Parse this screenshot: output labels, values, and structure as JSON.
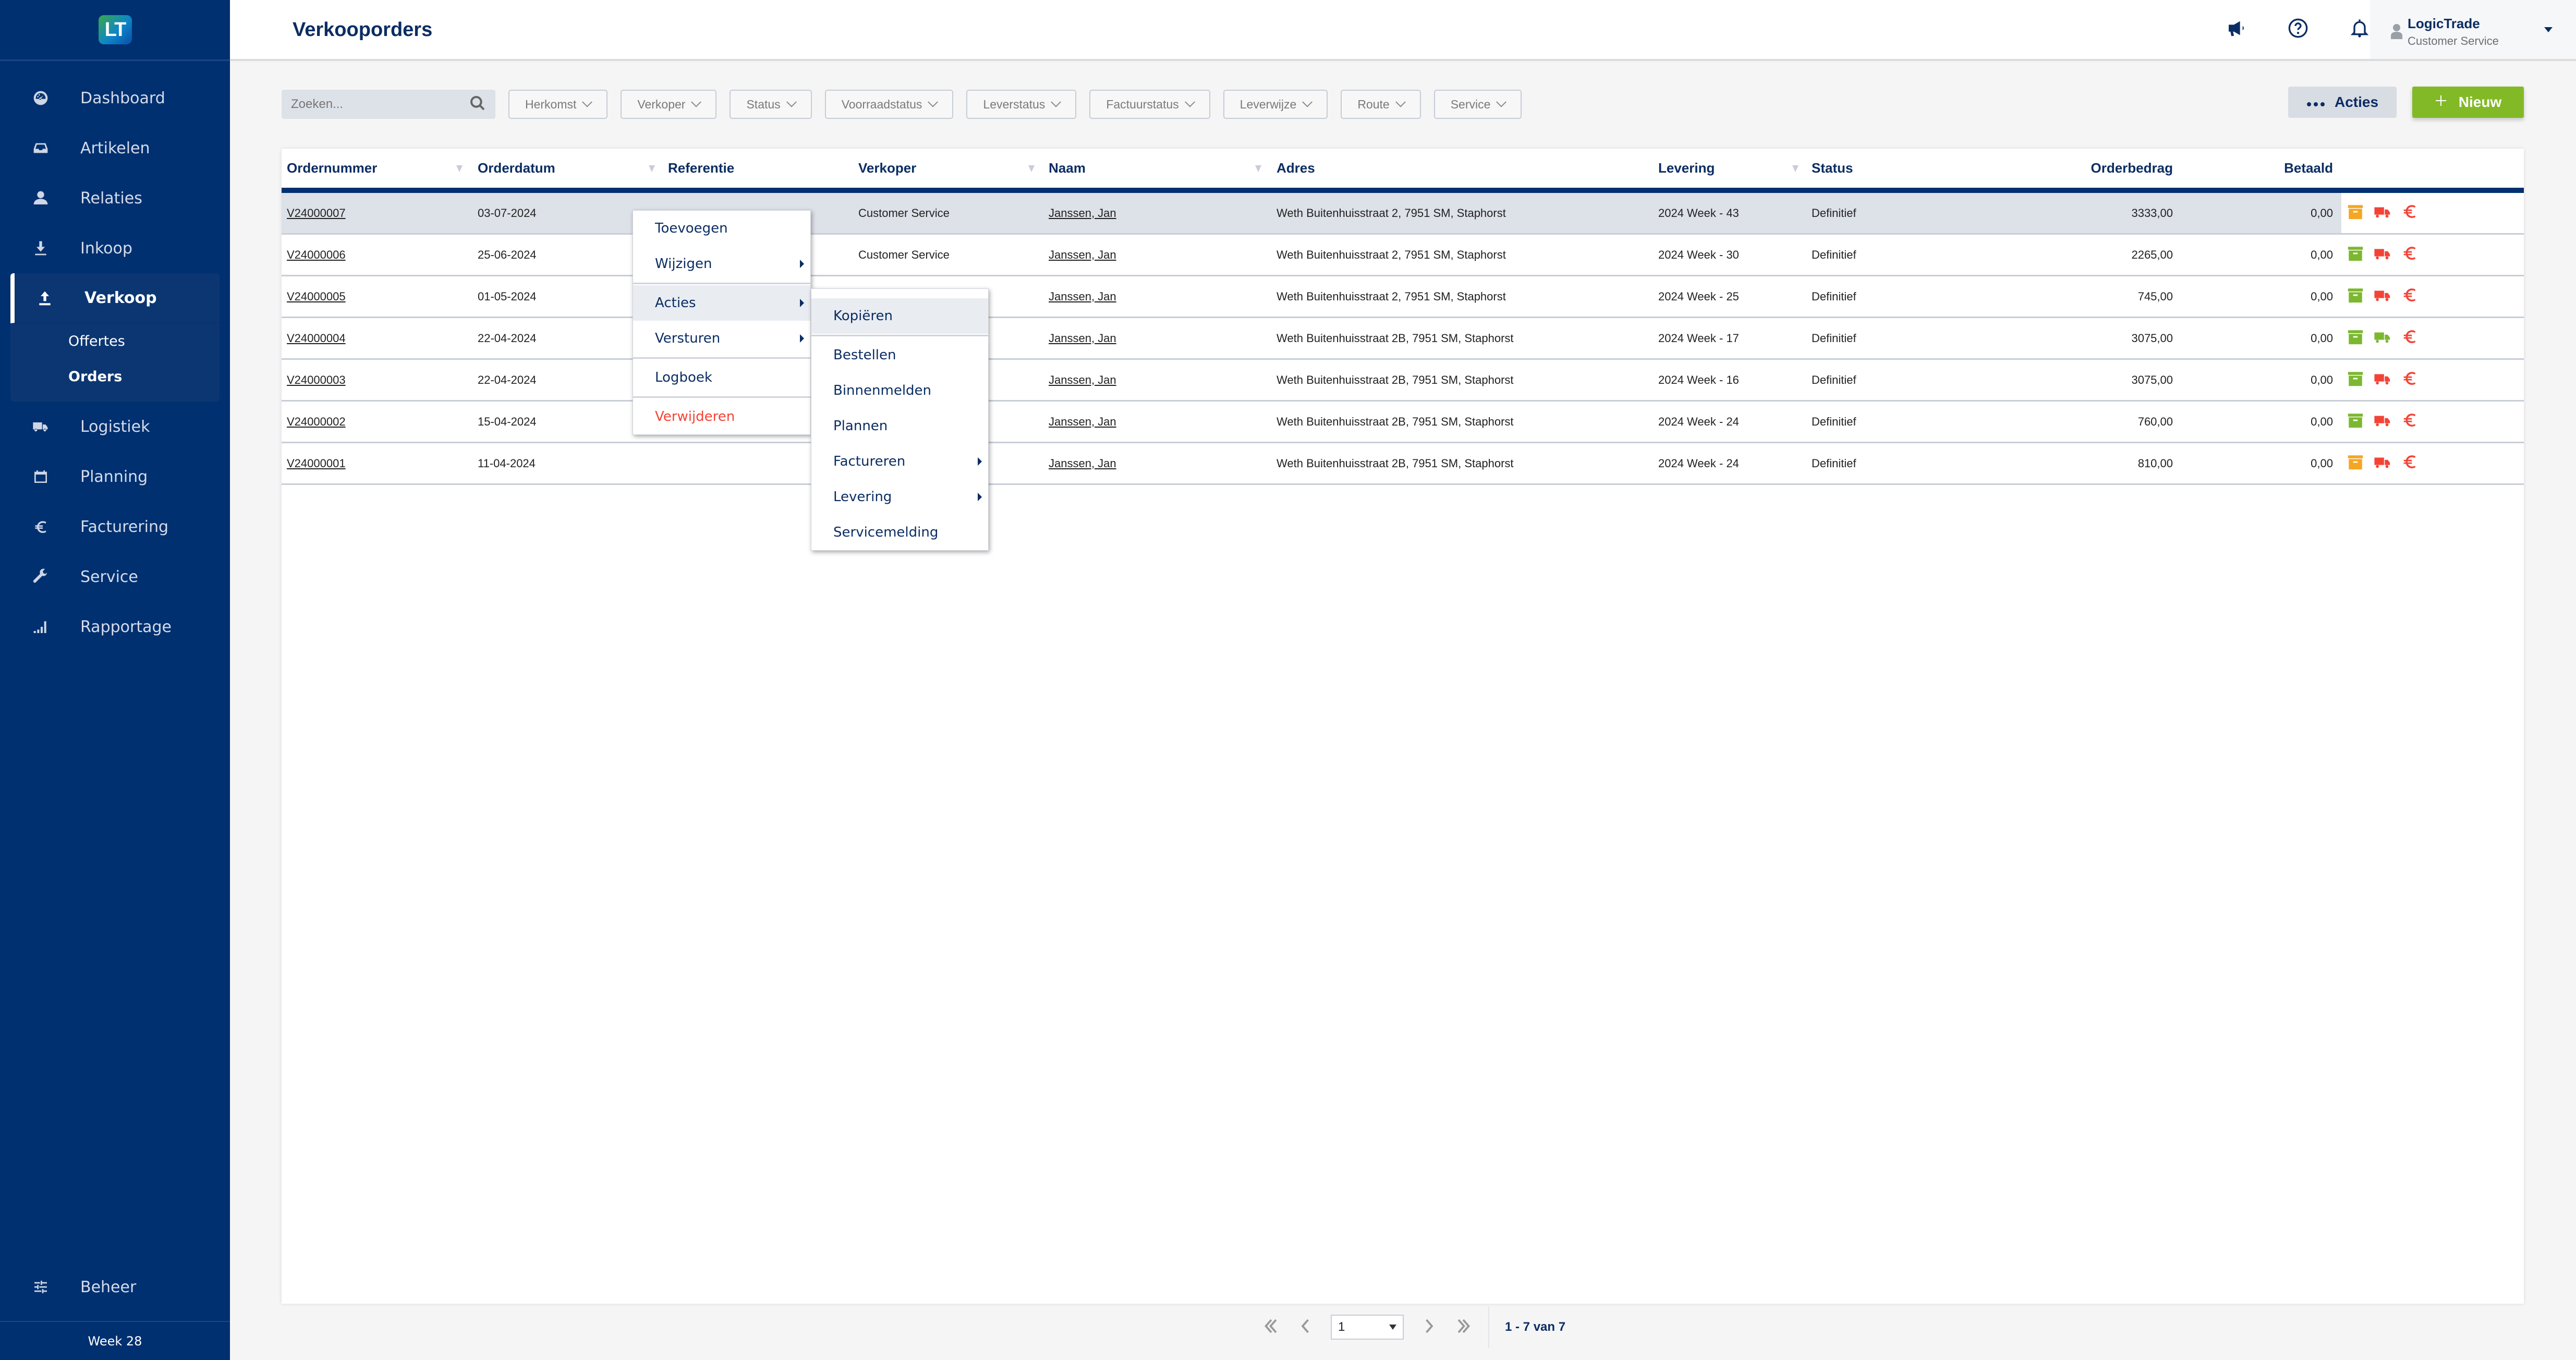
{
  "app": {
    "logo_text": "LT",
    "page_title": "Verkooporders",
    "week_label": "Week 28"
  },
  "sidebar": {
    "items": [
      {
        "label": "Dashboard",
        "icon": "dashboard-icon"
      },
      {
        "label": "Artikelen",
        "icon": "inbox-icon"
      },
      {
        "label": "Relaties",
        "icon": "user-icon"
      },
      {
        "label": "Inkoop",
        "icon": "download-icon"
      },
      {
        "label": "Verkoop",
        "icon": "upload-icon",
        "active": true,
        "children": [
          {
            "label": "Offertes"
          },
          {
            "label": "Orders",
            "active": true
          }
        ]
      },
      {
        "label": "Logistiek",
        "icon": "truck-icon"
      },
      {
        "label": "Planning",
        "icon": "calendar-icon"
      },
      {
        "label": "Facturering",
        "icon": "euro-icon"
      },
      {
        "label": "Service",
        "icon": "wrench-icon"
      },
      {
        "label": "Rapportage",
        "icon": "bar-chart-icon"
      }
    ],
    "bottom_item": {
      "label": "Beheer",
      "icon": "sliders-icon"
    }
  },
  "topbar": {
    "icons": [
      "megaphone-icon",
      "help-icon",
      "bell-icon"
    ],
    "user": {
      "name": "LogicTrade",
      "role": "Customer Service"
    }
  },
  "filters": {
    "search_placeholder": "Zoeken...",
    "dropdowns": [
      "Herkomst",
      "Verkoper",
      "Status",
      "Voorraadstatus",
      "Leverstatus",
      "Factuurstatus",
      "Leverwijze",
      "Route",
      "Service"
    ]
  },
  "actions": {
    "acties_label": "Acties",
    "nieuw_label": "Nieuw"
  },
  "table": {
    "columns": [
      "Ordernummer",
      "Orderdatum",
      "Referentie",
      "Verkoper",
      "Naam",
      "Adres",
      "Levering",
      "Status",
      "Orderbedrag",
      "Betaald"
    ],
    "rows": [
      {
        "ordernummer": "V24000007",
        "orderdatum": "03-07-2024",
        "referentie": "",
        "verkoper": "Customer  Service",
        "naam": "Janssen, Jan",
        "adres": "Weth Buitenhuisstraat 2, 7951 SM, Staphorst",
        "levering": "2024 Week - 43",
        "status": "Definitief",
        "orderbedrag": "3333,00",
        "betaald": "0,00",
        "box_color": "#f5a623",
        "truck_color": "#f44336",
        "euro_color": "#f44336",
        "selected": true
      },
      {
        "ordernummer": "V24000006",
        "orderdatum": "25-06-2024",
        "referentie": "",
        "verkoper": "Customer  Service",
        "naam": "Janssen, Jan",
        "adres": "Weth Buitenhuisstraat 2, 7951 SM, Staphorst",
        "levering": "2024 Week - 30",
        "status": "Definitief",
        "orderbedrag": "2265,00",
        "betaald": "0,00",
        "box_color": "#7cb82f",
        "truck_color": "#f44336",
        "euro_color": "#f44336"
      },
      {
        "ordernummer": "V24000005",
        "orderdatum": "01-05-2024",
        "referentie": "",
        "verkoper": "",
        "naam": "Janssen, Jan",
        "adres": "Weth Buitenhuisstraat 2, 7951 SM, Staphorst",
        "levering": "2024 Week - 25",
        "status": "Definitief",
        "orderbedrag": "745,00",
        "betaald": "0,00",
        "box_color": "#7cb82f",
        "truck_color": "#f44336",
        "euro_color": "#f44336"
      },
      {
        "ordernummer": "V24000004",
        "orderdatum": "22-04-2024",
        "referentie": "",
        "verkoper": "",
        "naam": "Janssen, Jan",
        "adres": "Weth Buitenhuisstraat 2B, 7951 SM, Staphorst",
        "levering": "2024 Week - 17",
        "status": "Definitief",
        "orderbedrag": "3075,00",
        "betaald": "0,00",
        "box_color": "#7cb82f",
        "truck_color": "#7cb82f",
        "euro_color": "#f44336"
      },
      {
        "ordernummer": "V24000003",
        "orderdatum": "22-04-2024",
        "referentie": "",
        "verkoper": "",
        "naam": "Janssen, Jan",
        "adres": "Weth Buitenhuisstraat 2B, 7951 SM, Staphorst",
        "levering": "2024 Week - 16",
        "status": "Definitief",
        "orderbedrag": "3075,00",
        "betaald": "0,00",
        "box_color": "#7cb82f",
        "truck_color": "#f44336",
        "euro_color": "#f44336"
      },
      {
        "ordernummer": "V24000002",
        "orderdatum": "15-04-2024",
        "referentie": "",
        "verkoper": "",
        "naam": "Janssen, Jan",
        "adres": "Weth Buitenhuisstraat 2B, 7951 SM, Staphorst",
        "levering": "2024 Week - 24",
        "status": "Definitief",
        "orderbedrag": "760,00",
        "betaald": "0,00",
        "box_color": "#7cb82f",
        "truck_color": "#f44336",
        "euro_color": "#f44336"
      },
      {
        "ordernummer": "V24000001",
        "orderdatum": "11-04-2024",
        "referentie": "",
        "verkoper": "",
        "naam": "Janssen, Jan",
        "adres": "Weth Buitenhuisstraat 2B, 7951 SM, Staphorst",
        "levering": "2024 Week - 24",
        "status": "Definitief",
        "orderbedrag": "810,00",
        "betaald": "0,00",
        "box_color": "#f5a623",
        "truck_color": "#f44336",
        "euro_color": "#f44336"
      }
    ]
  },
  "context_menu": {
    "items": [
      {
        "label": "Toevoegen"
      },
      {
        "label": "Wijzigen",
        "submenu": true
      },
      {
        "sep": true
      },
      {
        "label": "Acties",
        "submenu": true,
        "highlighted": true
      },
      {
        "label": "Versturen",
        "submenu": true
      },
      {
        "sep": true
      },
      {
        "label": "Logboek"
      },
      {
        "sep": true
      },
      {
        "label": "Verwijderen",
        "danger": true
      }
    ]
  },
  "submenu": {
    "items": [
      {
        "label": "Kopiëren",
        "highlighted": true
      },
      {
        "label": "Bestellen"
      },
      {
        "label": "Binnenmelden"
      },
      {
        "label": "Plannen"
      },
      {
        "label": "Factureren",
        "submenu": true
      },
      {
        "label": "Levering",
        "submenu": true
      },
      {
        "label": "Servicemelding"
      }
    ]
  },
  "pagination": {
    "current_page": "1",
    "info": "1 - 7 van 7"
  },
  "colors": {
    "brand_navy": "#003070",
    "accent_green": "#82ba27",
    "danger_red": "#f44336",
    "warning_orange": "#f5a623"
  }
}
